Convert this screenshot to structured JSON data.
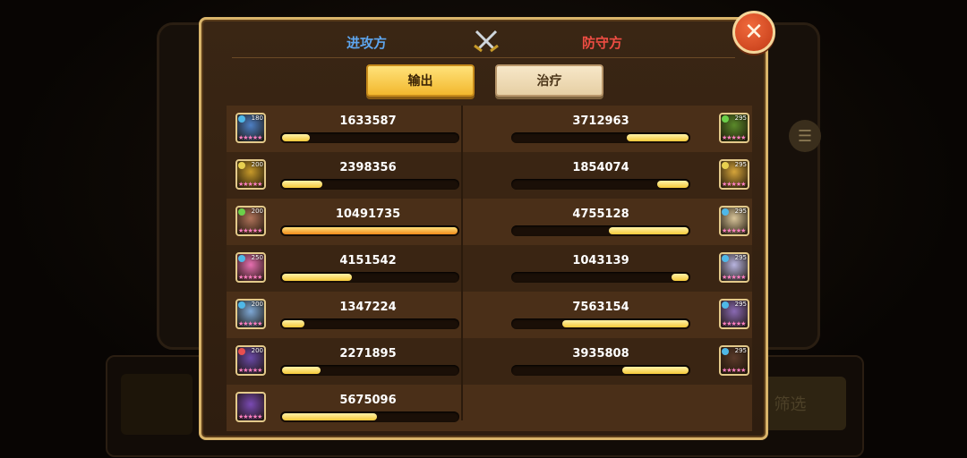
{
  "header": {
    "attacker_label": "进攻方",
    "defender_label": "防守方"
  },
  "tabs": [
    {
      "label": "输出",
      "selected": true
    },
    {
      "label": "治疗",
      "selected": false
    }
  ],
  "background": {
    "side_button_label": "筛选"
  },
  "colors": {
    "attacker": "#5ea6ef",
    "defender": "#ef4d43",
    "bar_fill": "#f5c93a",
    "bar_highlight": "#f08a1a",
    "border_gold": "#d9b46a"
  },
  "attackers": [
    {
      "value": "1633587",
      "level": "180",
      "ratio": 0.156,
      "portrait": "#4d7fc4",
      "element": "#4fb8e8"
    },
    {
      "value": "2398356",
      "level": "200",
      "ratio": 0.229,
      "portrait": "#c79a2a",
      "element": "#e8d04f"
    },
    {
      "value": "10491735",
      "level": "200",
      "ratio": 1.0,
      "portrait": "#b0735a",
      "element": "#6bd04a"
    },
    {
      "value": "4151542",
      "level": "250",
      "ratio": 0.396,
      "portrait": "#e66fb0",
      "element": "#4fb8e8"
    },
    {
      "value": "1347224",
      "level": "200",
      "ratio": 0.128,
      "portrait": "#7ea8d6",
      "element": "#4fb8e8"
    },
    {
      "value": "2271895",
      "level": "200",
      "ratio": 0.217,
      "portrait": "#6a4aa8",
      "element": "#e84f4f"
    },
    {
      "value": "5675096",
      "level": "",
      "ratio": 0.541,
      "portrait": "#7a4ab4",
      "element": ""
    }
  ],
  "defenders": [
    {
      "value": "3712963",
      "level": "295",
      "ratio": 0.354,
      "portrait": "#5a8a2a",
      "element": "#6bd04a"
    },
    {
      "value": "1854074",
      "level": "295",
      "ratio": 0.177,
      "portrait": "#d6a53a",
      "element": "#e8d04f"
    },
    {
      "value": "4755128",
      "level": "295",
      "ratio": 0.453,
      "portrait": "#d9c59a",
      "element": "#4fb8e8"
    },
    {
      "value": "1043139",
      "level": "295",
      "ratio": 0.099,
      "portrait": "#b8b4e0",
      "element": "#4fb8e8"
    },
    {
      "value": "7563154",
      "level": "295",
      "ratio": 0.721,
      "portrait": "#8a6ab4",
      "element": "#4fb8e8"
    },
    {
      "value": "3935808",
      "level": "295",
      "ratio": 0.375,
      "portrait": "#5a3a2a",
      "element": "#4fb8e8"
    }
  ]
}
